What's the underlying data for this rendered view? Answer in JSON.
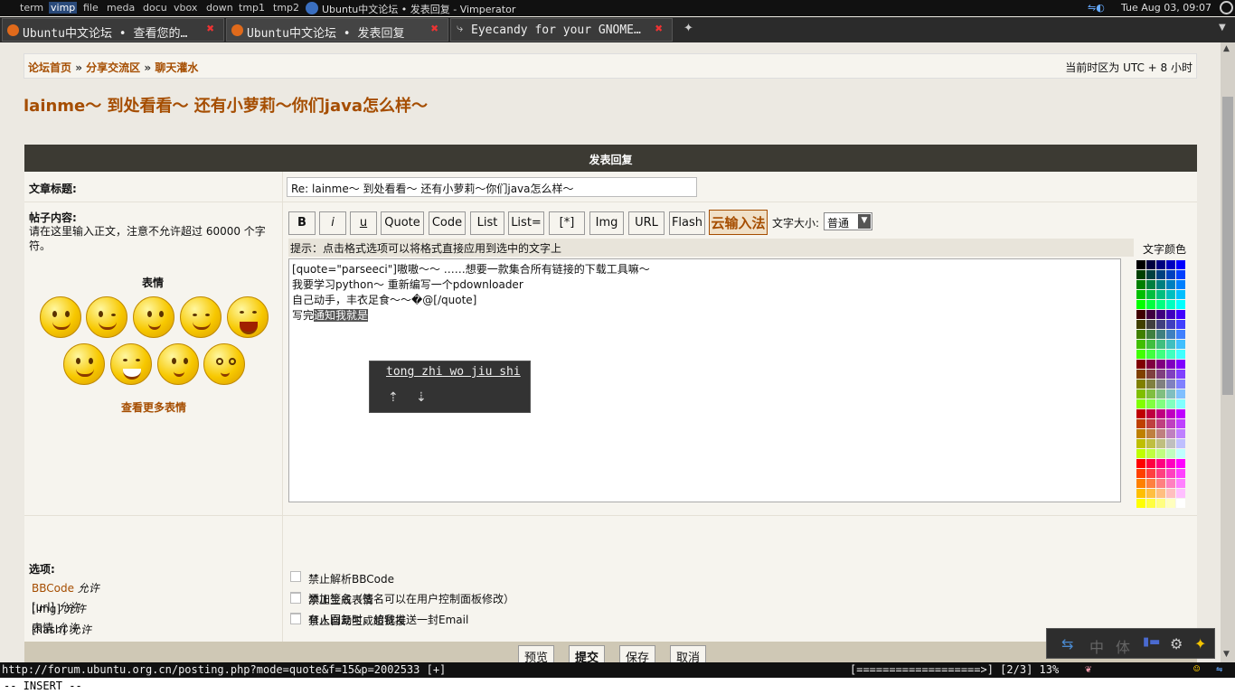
{
  "system_bar": {
    "workspaces": [
      "term",
      "vimp",
      "file",
      "meda",
      "docu",
      "vbox",
      "down",
      "tmp1",
      "tmp2"
    ],
    "active_workspace": "vimp",
    "window_title": "Ubuntu中文论坛 • 发表回复 - Vimperator",
    "clock": "Tue Aug 03, 09:07"
  },
  "tabs": [
    {
      "label": "Ubuntu中文论坛 • 查看您的…"
    },
    {
      "label": "Ubuntu中文论坛 • 发表回复"
    },
    {
      "label": "Eyecandy for your GNOME…"
    }
  ],
  "breadcrumb": {
    "items": [
      "论坛首页",
      "分享交流区",
      "聊天灌水"
    ],
    "sep": "»",
    "timezone": "当前时区为 UTC + 8 小时"
  },
  "topic_title": "lainme～ 到处看看～ 还有小萝莉～你们java怎么样～",
  "panel_title": "发表回复",
  "form": {
    "subject_label": "文章标题:",
    "subject_value": "Re: lainme～ 到处看看～ 还有小萝莉～你们java怎么样～",
    "content_label": "帖子内容:",
    "content_desc": "请在这里输入正文，注意不允许超过 60000 个字符。",
    "emoticons_title": "表情",
    "more_emoticons": "查看更多表情",
    "toolbar": [
      "B",
      "i",
      "u",
      "Quote",
      "Code",
      "List",
      "List=",
      "[*]",
      "Img",
      "URL",
      "Flash"
    ],
    "cloud_ime": "云输入法",
    "font_size_label": "文字大小:",
    "font_size_value": "普通",
    "hint": "提示：点击格式选项可以将格式直接应用到选中的文字上",
    "color_title": "文字颜色",
    "text_lines": [
      "[quote=\"parseeci\"]嗷嗷～～    ……想要一款集合所有链接的下载工具嘛～",
      "我要学习python～  重新编写一个pdownloader",
      "自己动手，丰衣足食～～�@[/quote]"
    ],
    "typing_prefix": "写完",
    "typing_preedit": "通知我就是",
    "ime_candidate": "tong zhi wo jiu shi",
    "options_label": "选项:",
    "options": [
      {
        "name": "BBCode",
        "state": "允许"
      },
      {
        "name": "[img]",
        "state": "允许"
      },
      {
        "name": "[flash]",
        "state": "允许"
      },
      {
        "name": "[url]",
        "state": "允许"
      },
      {
        "name": "表情",
        "state": "允许"
      }
    ],
    "checkboxes": [
      "禁止解析BBCode",
      "禁止生成表情",
      "禁止自动生成超链接",
      "添加签名（签名可以在用户控制面板修改）",
      "有人回复时，给我发送一封Email"
    ],
    "buttons": [
      "预览",
      "提交",
      "保存",
      "取消"
    ]
  },
  "ime_bar": [
    "中",
    "体"
  ],
  "status": {
    "url": "http://forum.ubuntu.org.cn/posting.php?mode=quote&f=15&p=2002533 [+]",
    "progress": "[===================>] [2/3] 13%",
    "progress_fraction": 0.13
  },
  "mode_line": "-- INSERT --"
}
